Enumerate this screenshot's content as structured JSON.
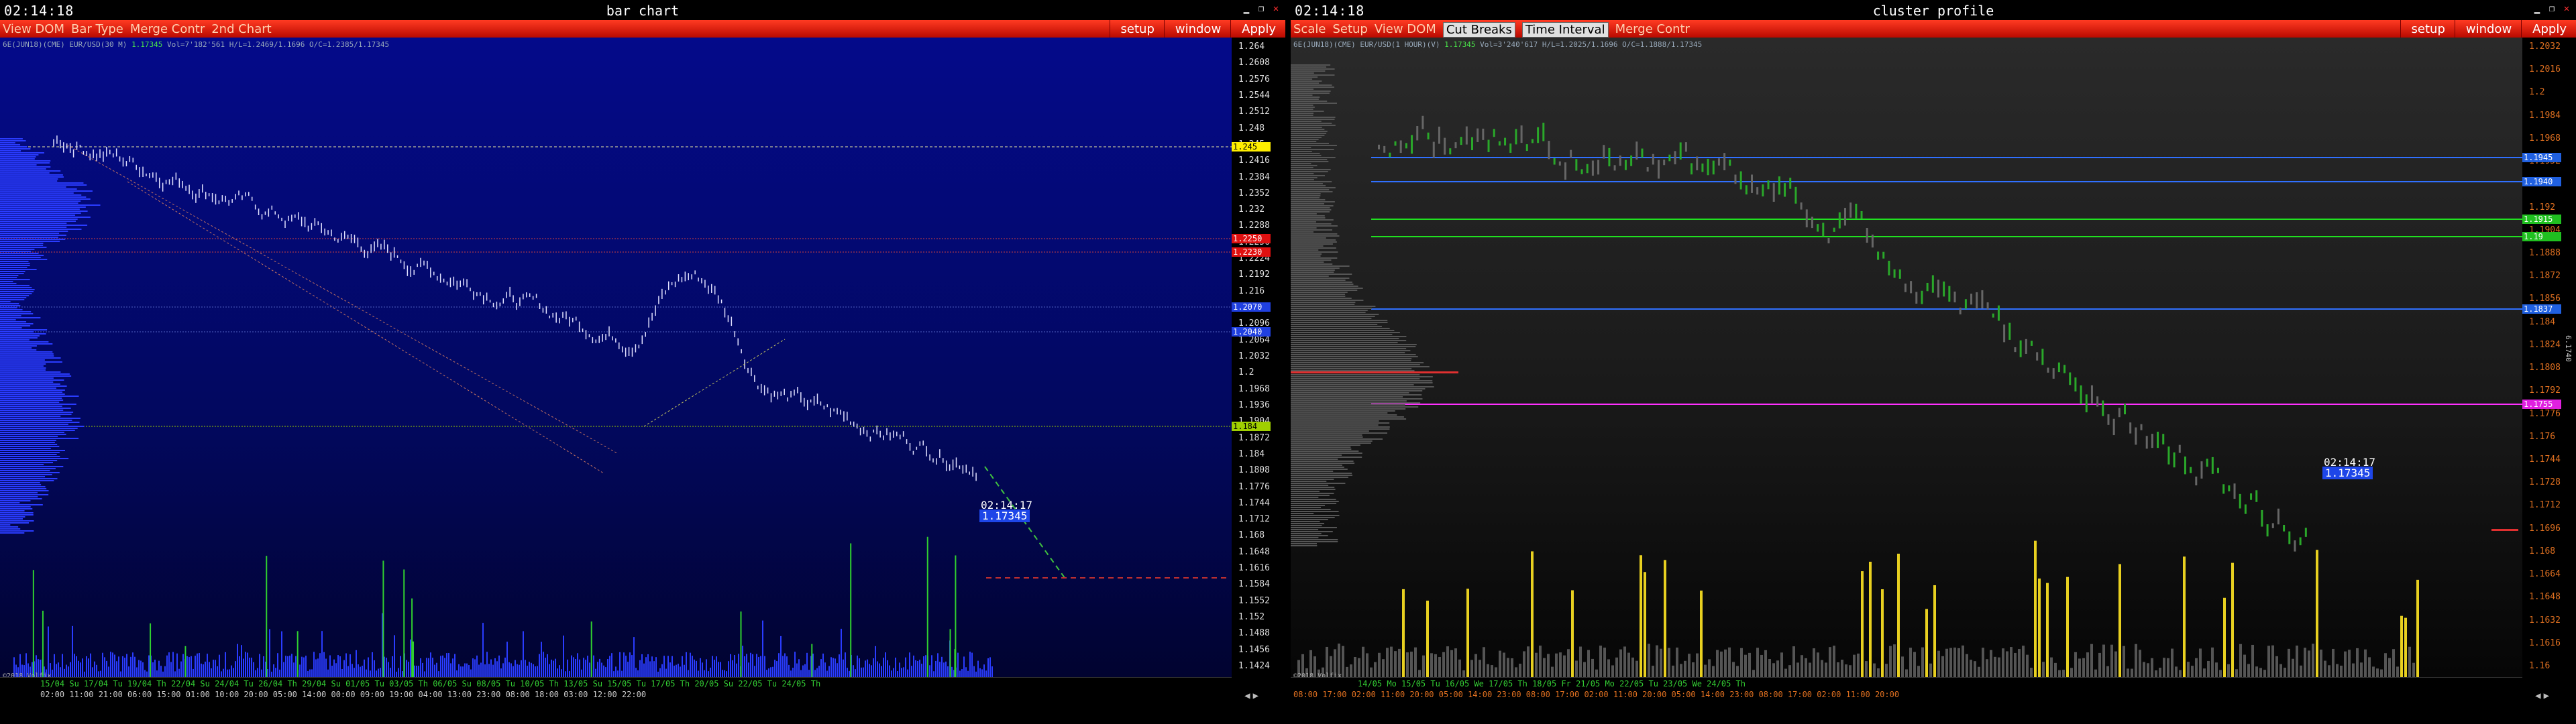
{
  "left": {
    "clock": "02:14:18",
    "title": "bar chart",
    "menu": [
      "View DOM",
      "Bar Type",
      "Merge Contr",
      "2nd Chart"
    ],
    "right_menu": [
      "setup",
      "window",
      "Apply"
    ],
    "info_prefix": "6E(JUN18)(CME) EUR/USD(30 M)",
    "info_price": "1.17345",
    "info_rest": "Vol=7'182'561 H/L=1.2469/1.1696 O/C=1.2385/1.17345",
    "price_ticks": [
      "1.264",
      "1.2608",
      "1.2576",
      "1.2544",
      "1.2512",
      "1.248",
      "1.245",
      "1.2416",
      "1.2384",
      "1.2352",
      "1.232",
      "1.2288",
      "1.2256",
      "1.2224",
      "1.2192",
      "1.216",
      "1.2128",
      "1.2096",
      "1.2064",
      "1.2032",
      "1.2",
      "1.1968",
      "1.1936",
      "1.1904",
      "1.1872",
      "1.184",
      "1.1808",
      "1.1776",
      "1.1744",
      "1.1712",
      "1.168",
      "1.1648",
      "1.1616",
      "1.1584",
      "1.1552",
      "1.152",
      "1.1488",
      "1.1456",
      "1.1424"
    ],
    "price_labels": [
      {
        "text": "1.245",
        "bg": "#ffee00",
        "fg": "#000",
        "line": "#e8e8a0"
      },
      {
        "text": "1.2250",
        "bg": "#e01010",
        "fg": "#fff",
        "line": "#d04040"
      },
      {
        "text": "1.2230",
        "bg": "#e01010",
        "fg": "#fff",
        "line": "#d04040"
      },
      {
        "text": "1.2070",
        "bg": "#2040e0",
        "fg": "#fff",
        "line": "#5060c0"
      },
      {
        "text": "1.2040",
        "bg": "#2040e0",
        "fg": "#fff",
        "line": "#5060c0"
      },
      {
        "text": "1.184",
        "bg": "#a0d000",
        "fg": "#000",
        "line": "#9ccc00"
      }
    ],
    "current_time": "02:14:17",
    "current_price": "1.17345",
    "time_row": "15/04 Su 17/04 Tu 19/04 Th 22/04 Su 24/04 Tu 26/04 Th 29/04 Su 01/05 Tu 03/05 Th 06/05 Su 08/05 Tu 10/05 Th 13/05 Su 15/05 Tu 17/05 Th 20/05 Su 22/05 Tu 24/05 Th",
    "hour_row": "02:00  11:00  21:00  06:00  15:00  01:00  10:00  20:00  05:00  14:00  00:00  09:00  19:00  04:00  13:00  23:00  08:00  18:00  03:00  12:00  22:00",
    "copyright": "©2018 Volfix"
  },
  "right": {
    "clock": "02:14:18",
    "title": "cluster profile",
    "menu": [
      "Scale",
      "Setup",
      "View DOM",
      "Cut Breaks",
      "Time Interval",
      "Merge Contr"
    ],
    "right_menu": [
      "setup",
      "window",
      "Apply"
    ],
    "info_prefix": "6E(JUN18)(CME) EUR/USD(1 HOUR)(V)",
    "info_price": "1.17345",
    "info_rest": "Vol=3'240'617 H/L=1.2025/1.1696 O/C=1.1888/1.17345",
    "price_ticks": [
      "1.2032",
      "1.2016",
      "1.2",
      "1.1984",
      "1.1968",
      "1.1952",
      "1.1936",
      "1.192",
      "1.1904",
      "1.1888",
      "1.1872",
      "1.1856",
      "1.184",
      "1.1824",
      "1.1808",
      "1.1792",
      "1.1776",
      "1.176",
      "1.1744",
      "1.1728",
      "1.1712",
      "1.1696",
      "1.168",
      "1.1664",
      "1.1648",
      "1.1632",
      "1.1616",
      "1.16"
    ],
    "price_labels": [
      {
        "text": "1.1945",
        "bg": "#2060e0",
        "fg": "#fff",
        "line": "#3070ff"
      },
      {
        "text": "1.1940",
        "bg": "#2060e0",
        "fg": "#fff",
        "line": "#3070ff"
      },
      {
        "text": "1.1915",
        "bg": "#20c020",
        "fg": "#fff",
        "line": "#20e020"
      },
      {
        "text": "1.19",
        "bg": "#20c020",
        "fg": "#fff",
        "line": "#20e020"
      },
      {
        "text": "1.1837",
        "bg": "#2060e0",
        "fg": "#fff",
        "line": "#3070ff"
      },
      {
        "text": "1.1755",
        "bg": "#e020e0",
        "fg": "#fff",
        "line": "#ff30ff"
      }
    ],
    "current_time": "02:14:17",
    "current_price": "1.17345",
    "side_tag": "6.1740",
    "time_row": "14/05 Mo  15/05 Tu  16/05 We  17/05 Th  18/05 Fr  21/05 Mo  22/05 Tu  23/05 We  24/05 Th",
    "hour_row": "08:00 17:00 02:00 11:00 20:00 05:00 14:00 23:00 08:00 17:00 02:00 11:00 20:00 05:00 14:00 23:00 08:00 17:00 02:00 11:00 20:00",
    "copyright": "©2018 Volfix"
  },
  "colors": {
    "menubar": "#e0200f",
    "left_bg": "#040a8a",
    "right_bg": "#222222",
    "green_bar": "#30d030",
    "yellow_bar": "#e8d020",
    "blue_volume": "#2a3cff"
  }
}
